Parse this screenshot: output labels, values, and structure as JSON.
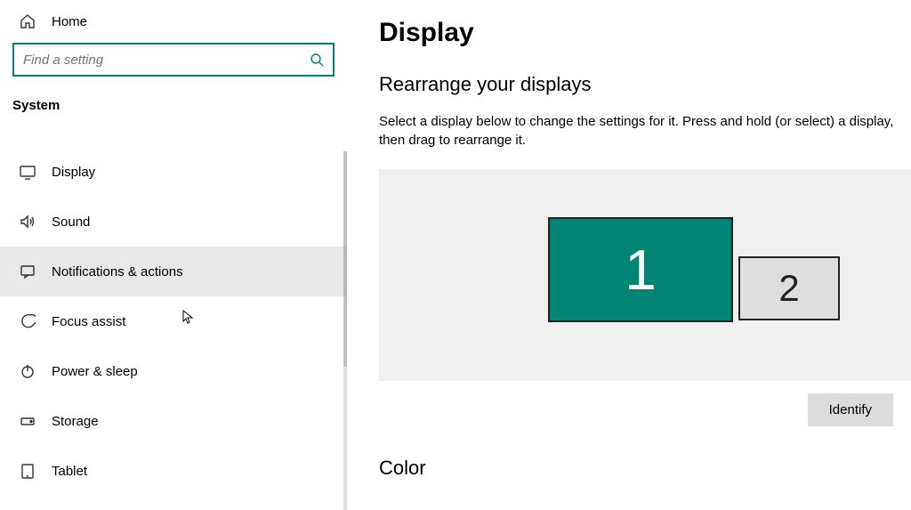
{
  "sidebar": {
    "home_label": "Home",
    "search_placeholder": "Find a setting",
    "group_title": "System",
    "items": [
      {
        "label": "Display"
      },
      {
        "label": "Sound"
      },
      {
        "label": "Notifications & actions"
      },
      {
        "label": "Focus assist"
      },
      {
        "label": "Power & sleep"
      },
      {
        "label": "Storage"
      },
      {
        "label": "Tablet"
      }
    ]
  },
  "main": {
    "page_title": "Display",
    "rearrange_title": "Rearrange your displays",
    "rearrange_desc": "Select a display below to change the settings for it. Press and hold (or select) a display, then drag to rearrange it.",
    "monitors": {
      "primary": "1",
      "secondary": "2"
    },
    "identify_label": "Identify",
    "color_title": "Color"
  }
}
